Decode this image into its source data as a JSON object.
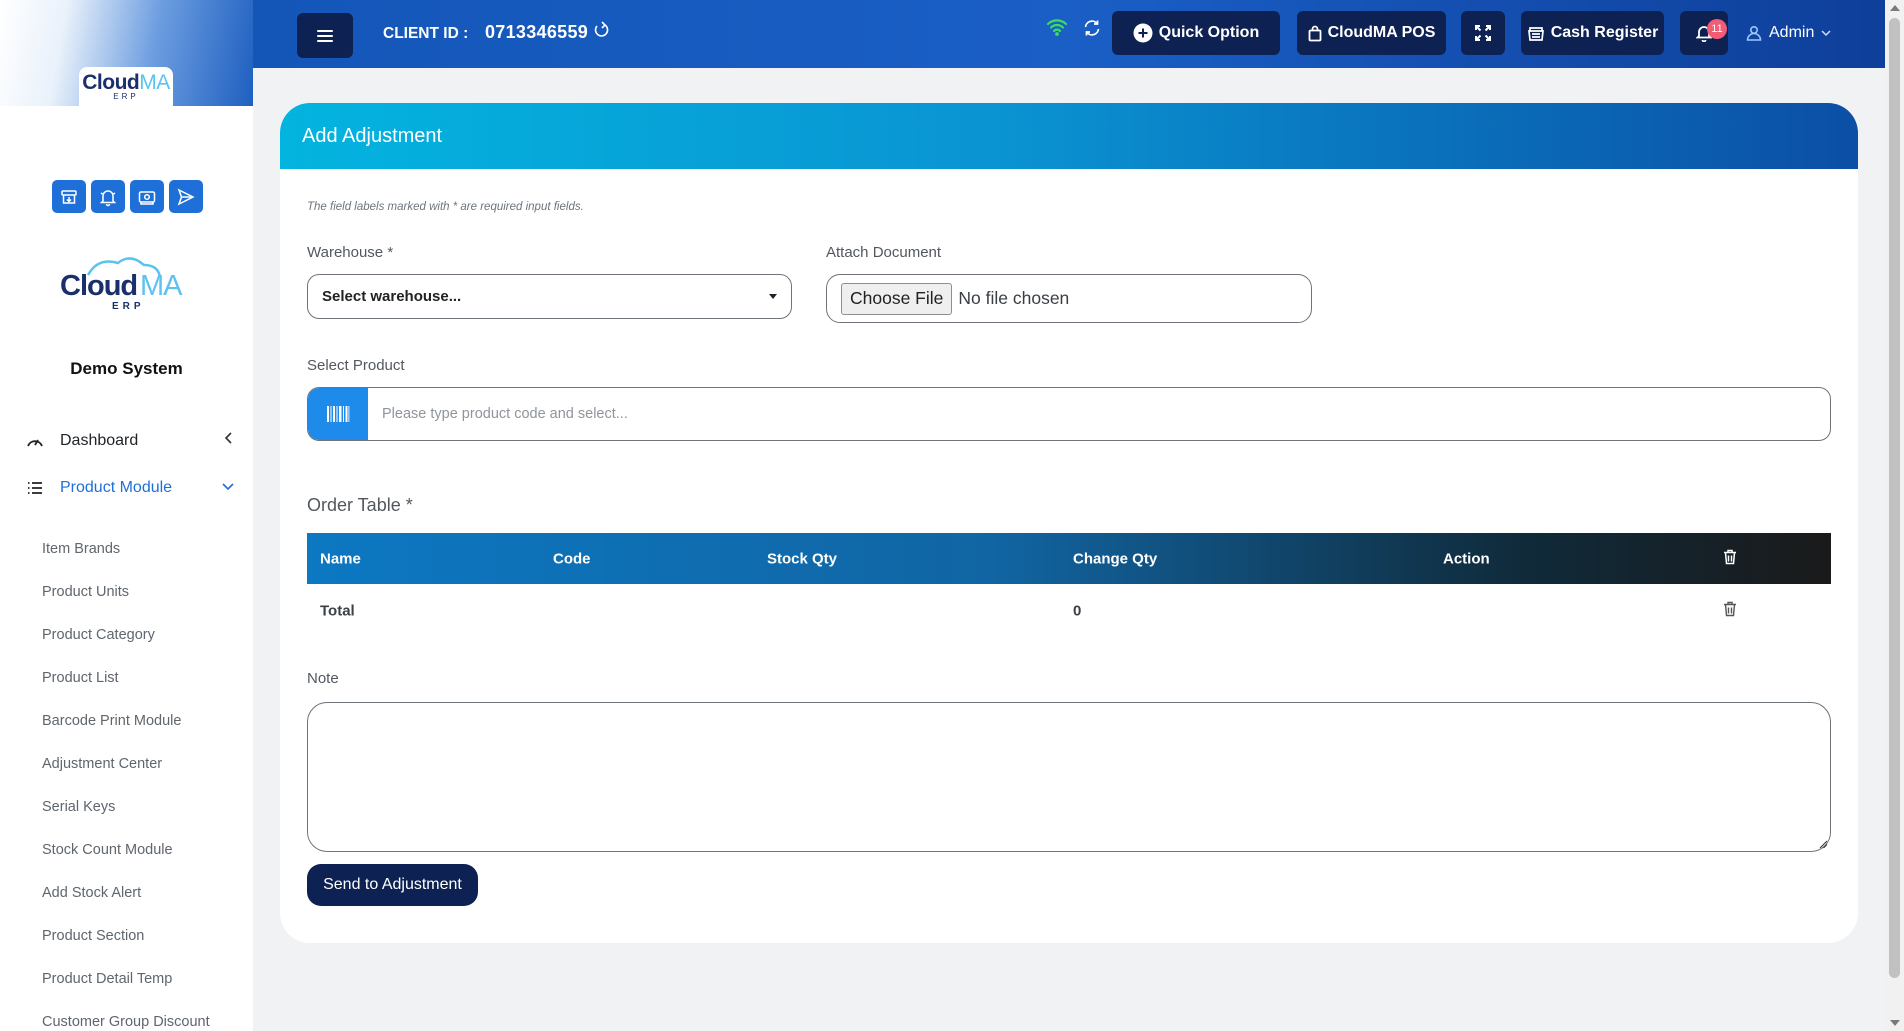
{
  "brand": {
    "logo_main": "Cloud",
    "logo_accent": "MA",
    "logo_sub": "ERP"
  },
  "sidebar": {
    "company_name": "Demo System",
    "quick_icons": [
      "archive-icon",
      "bell-icon",
      "money-icon",
      "send-icon"
    ],
    "nav": [
      {
        "label": "Dashboard",
        "icon": "gauge-icon",
        "expanded": false
      },
      {
        "label": "Product Module",
        "icon": "list-icon",
        "expanded": true
      }
    ],
    "sub_items": [
      "Item Brands",
      "Product Units",
      "Product Category",
      "Product List",
      "Barcode Print Module",
      "Adjustment Center",
      "Serial Keys",
      "Stock Count Module",
      "Add Stock Alert",
      "Product Section",
      "Product Detail Temp",
      "Customer Group Discount"
    ]
  },
  "header": {
    "client_label": "CLIENT ID :",
    "client_id": "0713346559",
    "quick_option": "Quick Option",
    "pos": "CloudMA POS",
    "cash_register": "Cash Register",
    "notifications": "11",
    "user": "Admin"
  },
  "form": {
    "title": "Add Adjustment",
    "required_note": "The field labels marked with * are required input fields.",
    "warehouse_label": "Warehouse *",
    "warehouse_value": "Select warehouse...",
    "attach_label": "Attach Document",
    "file_button": "Choose File",
    "file_status": "No file chosen",
    "product_label": "Select Product",
    "product_placeholder": "Please type product code and select...",
    "order_title": "Order Table *",
    "table": {
      "headers": [
        "Name",
        "Code",
        "Stock Qty",
        "Change Qty",
        "Action"
      ],
      "total_label": "Total",
      "total_change": "0"
    },
    "note_label": "Note",
    "submit": "Send to Adjustment"
  },
  "colors": {
    "header_blue": "#1a5fc6",
    "navy": "#0d2252",
    "accent_blue": "#1e70d8",
    "badge_red": "#f25c75",
    "card_head_start": "#03b4df",
    "card_head_end": "#0b4fa6"
  }
}
